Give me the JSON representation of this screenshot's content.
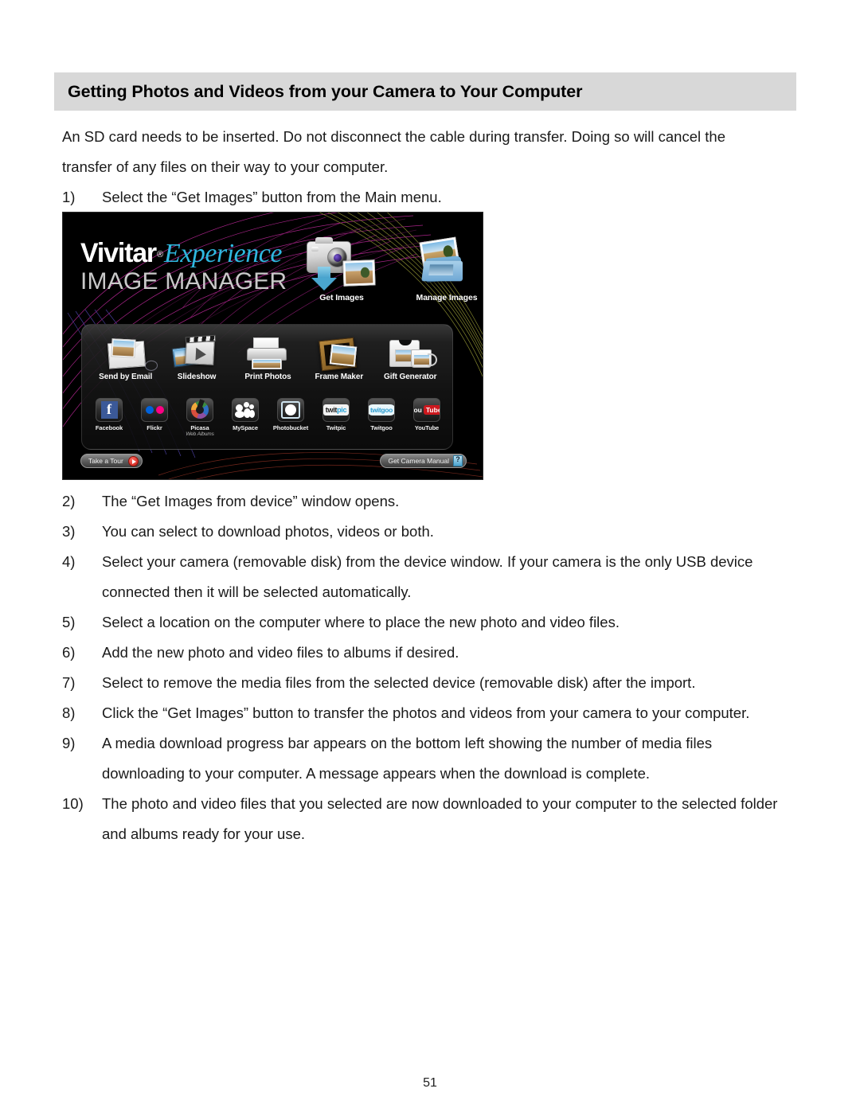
{
  "document": {
    "heading": "Getting Photos and Videos from your Camera to Your Computer",
    "intro": "An SD card needs to be inserted. Do not disconnect the cable during transfer. Doing so will cancel the transfer of any files on their way to your computer.",
    "page_number": "51"
  },
  "steps": [
    {
      "num": "1)",
      "text": "Select the “Get Images” button from the Main menu."
    },
    {
      "num": "2)",
      "text": "The “Get Images from device” window opens."
    },
    {
      "num": "3)",
      "text": "You can select to download photos, videos or both."
    },
    {
      "num": "4)",
      "text": "Select your camera (removable disk) from the device window. If your camera is the only USB device connected then it will be selected automatically."
    },
    {
      "num": "5)",
      "text": "Select a location on the computer where to place the new photo and video files."
    },
    {
      "num": "6)",
      "text": "Add the new photo and video files to albums if desired."
    },
    {
      "num": "7)",
      "text": "Select to remove the media files from the selected device (removable disk) after the import."
    },
    {
      "num": "8)",
      "text": "Click the “Get Images” button to transfer the photos and videos from your camera to your computer."
    },
    {
      "num": "9)",
      "text": "A media download progress bar appears on the bottom left showing the number of media files downloading to your computer. A message appears when the download is complete."
    },
    {
      "num": "10)",
      "text": "The photo and video files that you selected are now downloaded to your computer to the selected folder and albums ready for your use."
    }
  ],
  "app_screenshot": {
    "brand": {
      "name": "Vivitar",
      "registered_mark": "®",
      "product": "Experience",
      "subtitle": "IMAGE MANAGER",
      "brand_color": "#2fb8e0",
      "subtitle_color": "#c9c9c9"
    },
    "primary_actions": [
      {
        "label": "Get Images",
        "icon": "camera-download-icon"
      },
      {
        "label": "Manage Images",
        "icon": "photo-folder-icon"
      }
    ],
    "tools": [
      {
        "label": "Send by Email",
        "icon": "envelope-photo-icon"
      },
      {
        "label": "Slideshow",
        "icon": "clapperboard-play-icon"
      },
      {
        "label": "Print Photos",
        "icon": "printer-icon"
      },
      {
        "label": "Frame Maker",
        "icon": "picture-frame-icon"
      },
      {
        "label": "Gift Generator",
        "icon": "shirt-mug-icon"
      }
    ],
    "social_services": [
      {
        "label": "Facebook",
        "sub": "",
        "icon": "facebook-icon"
      },
      {
        "label": "Flickr",
        "sub": "",
        "icon": "flickr-icon"
      },
      {
        "label": "Picasa",
        "sub": "Web Albums",
        "icon": "picasa-icon"
      },
      {
        "label": "MySpace",
        "sub": "",
        "icon": "myspace-icon"
      },
      {
        "label": "Photobucket",
        "sub": "",
        "icon": "photobucket-icon"
      },
      {
        "label": "Twitpic",
        "sub": "",
        "icon": "twitpic-icon"
      },
      {
        "label": "Twitgoo",
        "sub": "",
        "icon": "twitgoo-icon"
      },
      {
        "label": "YouTube",
        "sub": "",
        "icon": "youtube-icon"
      }
    ],
    "footer_buttons": [
      {
        "label": "Take a Tour",
        "icon": "play-badge-icon"
      },
      {
        "label": "Get Camera Manual",
        "icon": "manual-badge-icon"
      }
    ],
    "youtube_parts": {
      "you": "You",
      "tube": "Tube"
    },
    "twitpic_parts": {
      "first": "twit",
      "second": "pic"
    },
    "twitgoo_text": "twitgoo"
  }
}
